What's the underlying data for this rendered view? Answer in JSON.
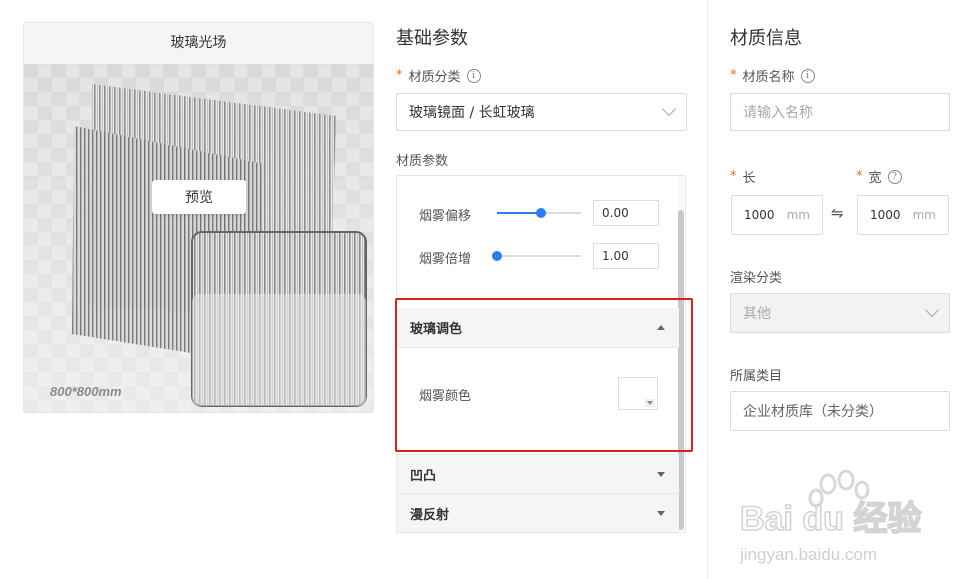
{
  "preview": {
    "title": "玻璃光场",
    "button": "预览",
    "floor_label": "800*800mm"
  },
  "basic": {
    "title": "基础参数",
    "category_label": "材质分类",
    "category_value": "玻璃镜面 / 长虹玻璃",
    "params_label": "材质参数",
    "params": [
      {
        "label": "烟雾偏移",
        "value": "0.00",
        "fraction": 0.52
      },
      {
        "label": "烟雾倍增",
        "value": "1.00",
        "fraction": 0.0
      }
    ],
    "sections": {
      "glass_tint": "玻璃调色",
      "smoke_color": "烟雾颜色",
      "bump": "凹凸",
      "diffuse": "漫反射"
    }
  },
  "material": {
    "title": "材质信息",
    "name_label": "材质名称",
    "name_placeholder": "请输入名称",
    "length_label": "长",
    "width_label": "宽",
    "length_value": "1000",
    "width_value": "1000",
    "unit": "mm",
    "render_label": "渲染分类",
    "render_value": "其他",
    "category_label": "所属类目",
    "category_value": "企业材质库（未分类）"
  },
  "watermark": {
    "brand": "Bai du 经验",
    "url": "jingyan.baidu.com"
  },
  "colors": {
    "accent": "#2f7df6",
    "required": "#f06a1f",
    "highlight": "#e02020"
  }
}
